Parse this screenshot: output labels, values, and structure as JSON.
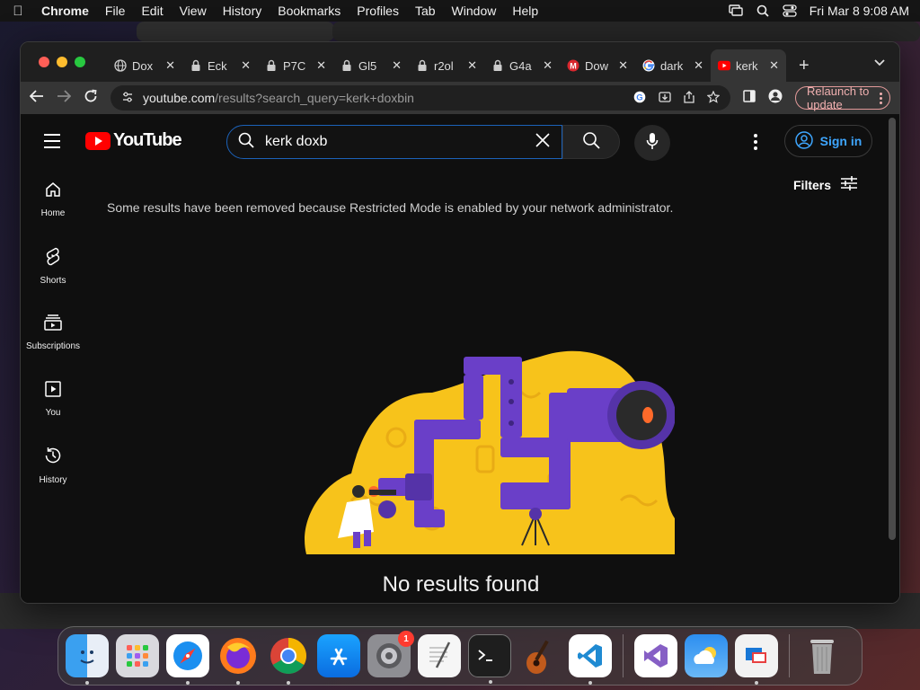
{
  "menubar": {
    "app_name": "Chrome",
    "items": [
      "File",
      "Edit",
      "View",
      "History",
      "Bookmarks",
      "Profiles",
      "Tab",
      "Window",
      "Help"
    ],
    "datetime": "Fri Mar 8  9:08 AM"
  },
  "browser": {
    "tabs": [
      {
        "label": "Dox",
        "icon": "globe-icon"
      },
      {
        "label": "Eck",
        "icon": "lock-icon"
      },
      {
        "label": "P7C",
        "icon": "lock-icon"
      },
      {
        "label": "Gl5",
        "icon": "lock-icon"
      },
      {
        "label": "r2ol",
        "icon": "lock-icon"
      },
      {
        "label": "G4a",
        "icon": "lock-icon"
      },
      {
        "label": "Dow",
        "icon": "mega-icon"
      },
      {
        "label": "dark",
        "icon": "google-icon"
      },
      {
        "label": "kerk",
        "icon": "youtube-icon",
        "active": true
      }
    ],
    "address": {
      "host": "youtube.com",
      "path": "/results?search_query=kerk+doxbin"
    },
    "relaunch_label": "Relaunch to update"
  },
  "youtube": {
    "logo_text": "YouTube",
    "search_value": "kerk doxb",
    "signin_label": "Sign in",
    "sidebar": [
      {
        "label": "Home",
        "icon": "home-icon"
      },
      {
        "label": "Shorts",
        "icon": "shorts-icon"
      },
      {
        "label": "Subscriptions",
        "icon": "subscriptions-icon"
      },
      {
        "label": "You",
        "icon": "library-icon"
      },
      {
        "label": "History",
        "icon": "history-icon"
      }
    ],
    "filters_label": "Filters",
    "notice": "Some results have been removed because Restricted Mode is enabled by your network administrator.",
    "no_results": "No results found"
  },
  "dock": {
    "apps": [
      "Finder",
      "Launchpad",
      "Safari",
      "Firefox",
      "Chrome",
      "App Store",
      "System Settings",
      "TextEdit",
      "Terminal",
      "GarageBand",
      "VS Code",
      "Visual Studio",
      "Weather",
      "Remote Desktop",
      "Trash"
    ],
    "settings_badge": "1"
  },
  "colors": {
    "yt_red": "#ff0000",
    "link_blue": "#3ea6ff",
    "illus_yellow": "#f7c31b",
    "illus_purple": "#6a3fc8"
  }
}
